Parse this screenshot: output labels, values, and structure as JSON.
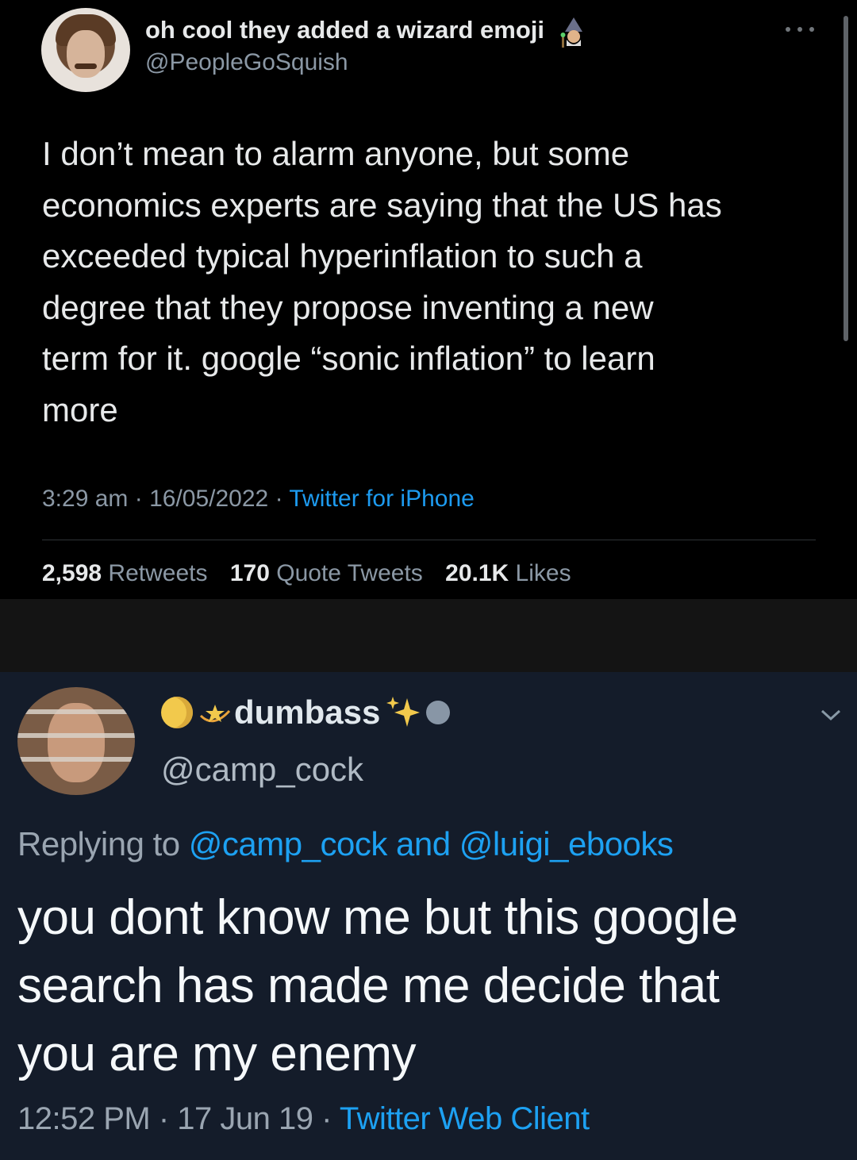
{
  "tweet1": {
    "display_name": "oh cool they added a wizard emoji",
    "name_emoji": "wizard-emoji",
    "handle": "@PeopleGoSquish",
    "body_lines": [
      "I don’t mean to alarm anyone, but some",
      "economics experts are saying that the US has",
      "exceeded typical hyperinflation to such a",
      "degree that they propose inventing a new",
      "term for it. google “sonic inflation” to learn",
      "more"
    ],
    "time": "3:29 am",
    "date": "16/05/2022",
    "source": "Twitter for iPhone",
    "separator": "·",
    "stats": {
      "retweets_count": "2,598",
      "retweets_label": "Retweets",
      "quotes_count": "170",
      "quotes_label": "Quote Tweets",
      "likes_count": "20.1K",
      "likes_label": "Likes"
    }
  },
  "tweet2": {
    "display_name": "dumbass",
    "name_emojis": [
      "moon-icon",
      "shooting-star-icon",
      "sparkles-icon",
      "circle-icon"
    ],
    "handle": "@camp_cock",
    "replying_prefix": "Replying to",
    "reply_handle_1": "@camp_cock",
    "reply_and": "and",
    "reply_handle_2": "@luigi_ebooks",
    "body_lines": [
      "you dont know me but this google",
      "search has made me decide that",
      "you are my enemy"
    ],
    "time": "12:52 PM",
    "date": "17 Jun 19",
    "source": "Twitter Web Client",
    "separator": "·"
  },
  "colors": {
    "accent": "#1d9bf0",
    "panel1_bg": "#000000",
    "panel2_bg": "#141c2a"
  }
}
